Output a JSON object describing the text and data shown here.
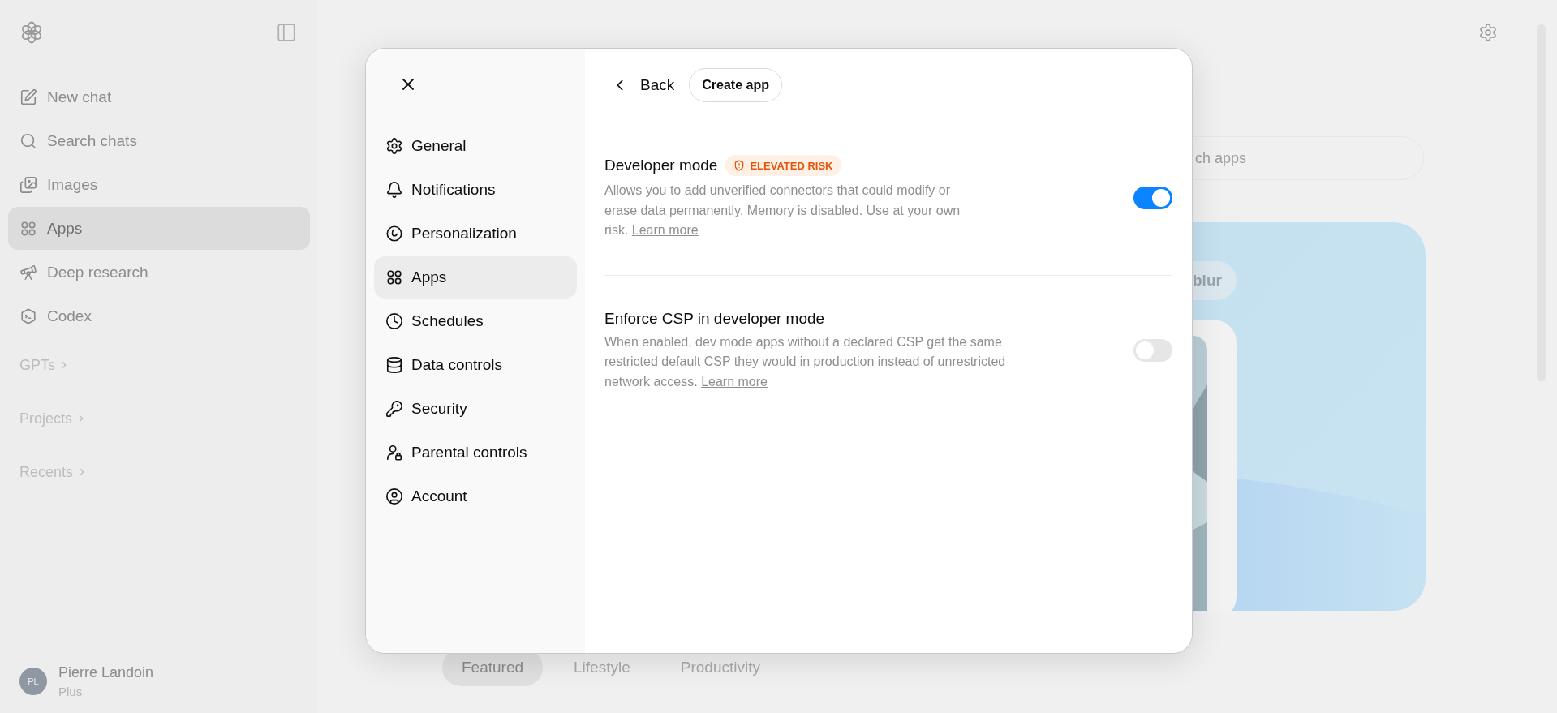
{
  "sidebar": {
    "items": [
      {
        "label": "New chat",
        "selected": false
      },
      {
        "label": "Search chats",
        "selected": false
      },
      {
        "label": "Images",
        "selected": false
      },
      {
        "label": "Apps",
        "selected": true
      },
      {
        "label": "Deep research",
        "selected": false
      },
      {
        "label": "Codex",
        "selected": false
      }
    ],
    "sections": [
      {
        "label": "GPTs"
      },
      {
        "label": "Projects"
      },
      {
        "label": "Recents"
      }
    ],
    "user": {
      "initials": "PL",
      "name": "Pierre Landoin",
      "plan": "Plus"
    }
  },
  "main": {
    "search": {
      "placeholder": "ch apps"
    },
    "card_chip": "blur",
    "tabs": [
      {
        "label": "Featured",
        "selected": true
      },
      {
        "label": "Lifestyle",
        "selected": false
      },
      {
        "label": "Productivity",
        "selected": false
      }
    ]
  },
  "settings_dialog": {
    "nav": [
      {
        "label": "General",
        "selected": false
      },
      {
        "label": "Notifications",
        "selected": false
      },
      {
        "label": "Personalization",
        "selected": false
      },
      {
        "label": "Apps",
        "selected": true
      },
      {
        "label": "Schedules",
        "selected": false
      },
      {
        "label": "Data controls",
        "selected": false
      },
      {
        "label": "Security",
        "selected": false
      },
      {
        "label": "Parental controls",
        "selected": false
      },
      {
        "label": "Account",
        "selected": false
      }
    ],
    "back": "Back",
    "create_button": "Create app",
    "settings": [
      {
        "title": "Developer mode",
        "badge": "ELEVATED RISK",
        "description": "Allows you to add unverified connectors that could modify or erase data permanently. Memory is disabled. Use at your own risk.",
        "link": "Learn more",
        "on": true
      },
      {
        "title": "Enforce CSP in developer mode",
        "description": "When enabled, dev mode apps without a declared CSP get the same restricted default CSP they would in production instead of unrestricted network access.",
        "link": "Learn more",
        "on": false
      }
    ]
  }
}
